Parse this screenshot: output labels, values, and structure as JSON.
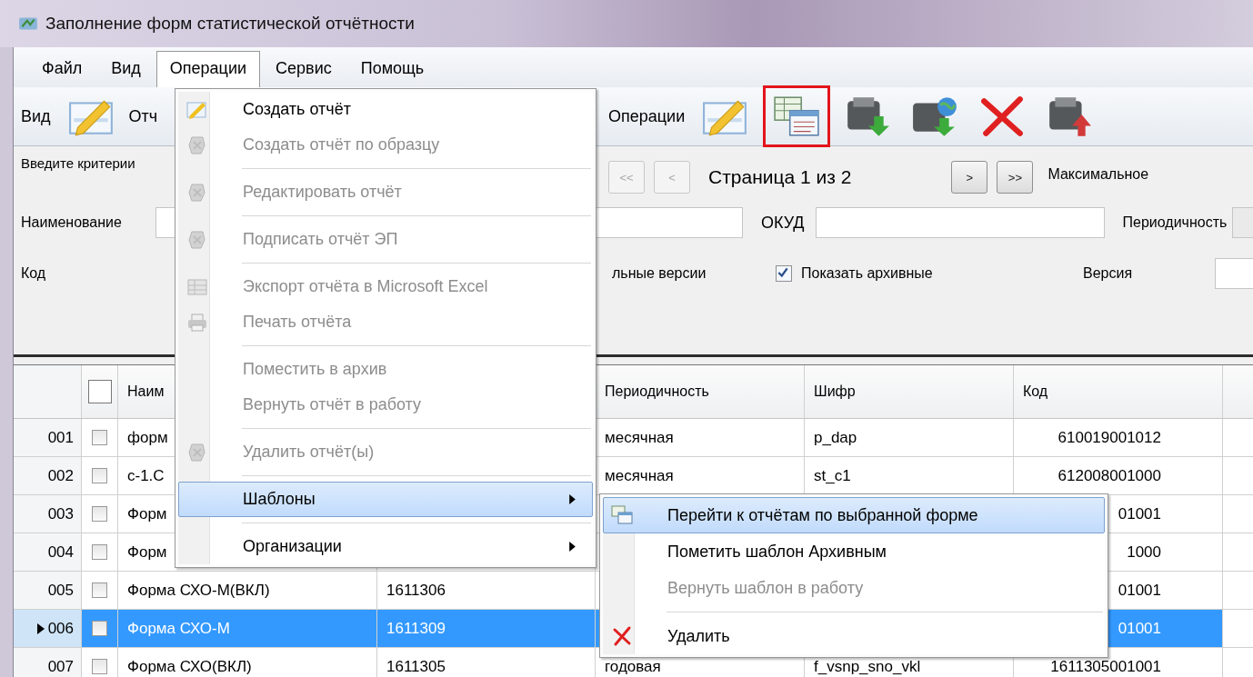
{
  "window": {
    "title": "Заполнение форм статистической отчётности"
  },
  "menubar": [
    {
      "label": "Файл",
      "selected": false
    },
    {
      "label": "Вид",
      "selected": false
    },
    {
      "label": "Операции",
      "selected": true
    },
    {
      "label": "Сервис",
      "selected": false
    },
    {
      "label": "Помощь",
      "selected": false
    }
  ],
  "toolbars": [
    {
      "label": "Вид",
      "buttons": [
        {
          "kind": "pencil",
          "highlighted": false
        }
      ],
      "trailing_text": "Отч"
    },
    {
      "label": "Операции",
      "buttons": [
        {
          "kind": "pencil",
          "highlighted": false
        },
        {
          "kind": "tables",
          "highlighted": true
        },
        {
          "kind": "printer-down",
          "highlighted": false
        },
        {
          "kind": "printer-globe",
          "highlighted": false
        },
        {
          "kind": "cross",
          "highlighted": false
        },
        {
          "kind": "printer-up",
          "highlighted": false
        }
      ]
    }
  ],
  "filter": {
    "caption": "Введите критерии",
    "name_label": "Наименование",
    "code_label": "Код",
    "versions_text": "льные версии",
    "okud_label": "ОКУД",
    "periodicity_label": "Периодичность",
    "show_archived": {
      "label": "Показать архивные",
      "checked": true
    },
    "version_label": "Версия",
    "pager": {
      "first": {
        "label": "<<",
        "disabled": true
      },
      "prev": {
        "label": "<",
        "disabled": true
      },
      "page_text": "Страница 1 из 2",
      "next": {
        "label": ">",
        "disabled": false
      },
      "last": {
        "label": ">>",
        "disabled": false
      },
      "max_label": "Максимальное"
    }
  },
  "table": {
    "header_checked": false,
    "columns": {
      "name": "Наим",
      "periodicity": "Периодичность",
      "cipher": "Шифр",
      "code": "Код"
    },
    "rows": [
      {
        "number": "001",
        "checked": false,
        "selected": false,
        "name": "форм",
        "periodicity": "месячная",
        "cipher": "p_dap",
        "code": "610019001012"
      },
      {
        "number": "002",
        "checked": false,
        "selected": false,
        "name": "с-1.С",
        "periodicity": "месячная",
        "cipher": "st_c1",
        "code": "612008001000"
      },
      {
        "number": "003",
        "checked": false,
        "selected": false,
        "name": "Форм",
        "code": "01001"
      },
      {
        "number": "004",
        "checked": false,
        "selected": false,
        "name": "Форм",
        "code": "1000"
      },
      {
        "number": "005",
        "checked": false,
        "selected": false,
        "name": "Форма СХО-М(ВКЛ)",
        "column_3": "1611306",
        "code": "01001"
      },
      {
        "number": "006",
        "checked": false,
        "selected": true,
        "name": "Форма СХО-М",
        "column_3": "1611309",
        "code": "01001"
      },
      {
        "number": "007",
        "checked": false,
        "selected": false,
        "name": "Форма СХО(ВКЛ)",
        "column_3": "1611305",
        "periodicity": "годовая",
        "cipher": "f_vsnp_sno_vkl",
        "code": "1611305001001"
      }
    ]
  },
  "operations_menu": {
    "items": [
      {
        "kind": "pencil",
        "label": "Создать отчёт",
        "disabled": false,
        "selected": false,
        "submenu": false
      },
      {
        "kind": "stamp",
        "label": "Создать отчёт по образцу",
        "disabled": true,
        "selected": false,
        "submenu": false
      },
      {
        "kind": "separator"
      },
      {
        "kind": "stamp",
        "label": "Редактировать отчёт",
        "disabled": true,
        "selected": false,
        "submenu": false
      },
      {
        "kind": "separator"
      },
      {
        "kind": "stamp",
        "label": "Подписать отчёт ЭП",
        "disabled": true,
        "selected": false,
        "submenu": false
      },
      {
        "kind": "separator"
      },
      {
        "kind": "excel",
        "label": "Экспорт отчёта в Microsoft Excel",
        "disabled": true,
        "selected": false,
        "submenu": false
      },
      {
        "kind": "printer",
        "label": "Печать отчёта",
        "disabled": true,
        "selected": false,
        "submenu": false
      },
      {
        "kind": "separator"
      },
      {
        "kind": "plain",
        "label": "Поместить в архив",
        "disabled": true,
        "selected": false,
        "submenu": false
      },
      {
        "kind": "plain",
        "label": "Вернуть отчёт в работу",
        "disabled": true,
        "selected": false,
        "submenu": false
      },
      {
        "kind": "separator"
      },
      {
        "kind": "stamp",
        "label": "Удалить отчёт(ы)",
        "disabled": true,
        "selected": false,
        "submenu": false
      },
      {
        "kind": "separator"
      },
      {
        "kind": "plain",
        "label": "Шаблоны",
        "disabled": false,
        "selected": true,
        "submenu": true
      },
      {
        "kind": "separator"
      },
      {
        "kind": "plain",
        "label": "Организации",
        "disabled": false,
        "selected": false,
        "submenu": true
      }
    ]
  },
  "templates_submenu": {
    "items": [
      {
        "kind": "tables",
        "label": "Перейти к отчётам по выбранной форме",
        "disabled": false,
        "selected": true
      },
      {
        "kind": "plain",
        "label": "Пометить шаблон Архивным",
        "disabled": false,
        "selected": false
      },
      {
        "kind": "plain",
        "label": "Вернуть шаблон в работу",
        "disabled": true,
        "selected": false
      },
      {
        "kind": "separator"
      },
      {
        "kind": "cross",
        "label": "Удалить",
        "disabled": false,
        "selected": false
      }
    ]
  }
}
